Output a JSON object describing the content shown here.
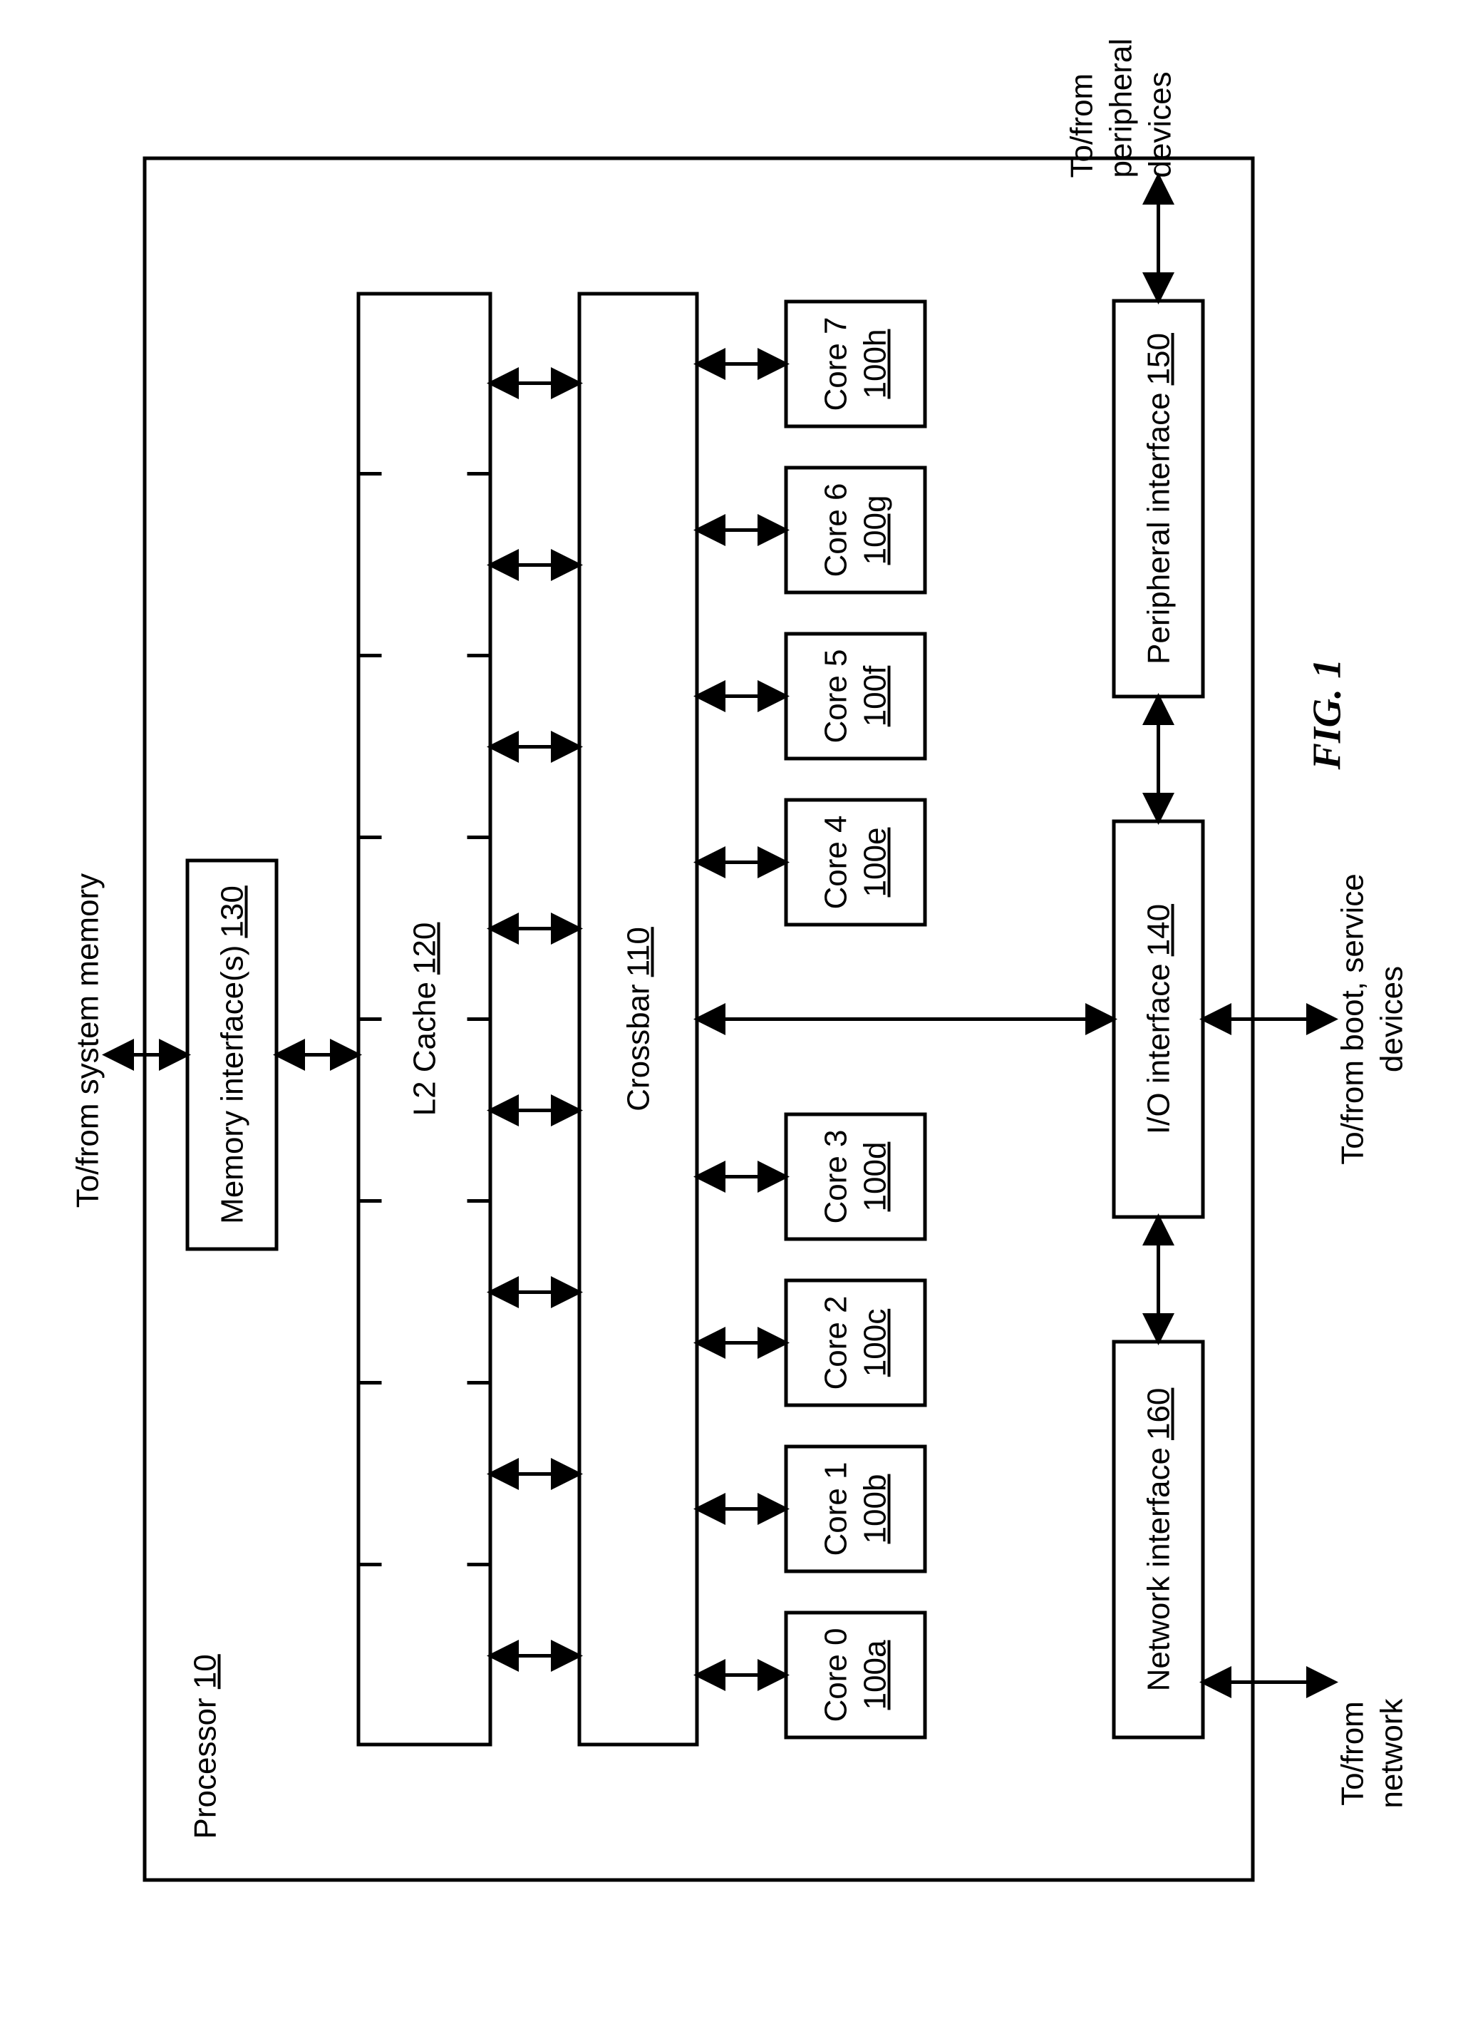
{
  "figure_label": "FIG. 1",
  "processor": {
    "label": "Processor",
    "ref": "10"
  },
  "memory_if": {
    "label": "Memory interface(s)",
    "ref": "130"
  },
  "l2": {
    "label": "L2 Cache",
    "ref": "120"
  },
  "crossbar": {
    "label": "Crossbar",
    "ref": "110"
  },
  "cores": [
    {
      "label": "Core 0",
      "ref": "100a"
    },
    {
      "label": "Core 1",
      "ref": "100b"
    },
    {
      "label": "Core 2",
      "ref": "100c"
    },
    {
      "label": "Core 3",
      "ref": "100d"
    },
    {
      "label": "Core 4",
      "ref": "100e"
    },
    {
      "label": "Core 5",
      "ref": "100f"
    },
    {
      "label": "Core 6",
      "ref": "100g"
    },
    {
      "label": "Core 7",
      "ref": "100h"
    }
  ],
  "net_if": {
    "label": "Network interface",
    "ref": "160"
  },
  "io_if": {
    "label": "I/O interface",
    "ref": "140"
  },
  "periph_if": {
    "label": "Peripheral interface",
    "ref": "150"
  },
  "ext": {
    "mem": "To/from system memory",
    "net": "To/from network",
    "boot": "To/from boot, service devices",
    "periph": "To/from peripheral devices"
  }
}
